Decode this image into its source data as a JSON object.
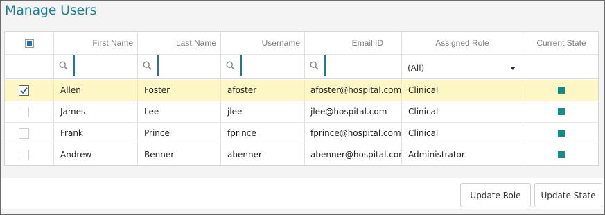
{
  "page": {
    "title": "Manage Users"
  },
  "grid": {
    "columns": [
      "First Name",
      "Last Name",
      "Username",
      "Email ID",
      "Assigned Role",
      "Current State"
    ],
    "role_filter": {
      "selected": "(All)"
    },
    "rows": [
      {
        "first": "Allen",
        "last": "Foster",
        "username": "afoster",
        "email": "afoster@hospital.com",
        "role": "Clinical",
        "checked": true
      },
      {
        "first": "James",
        "last": "Lee",
        "username": "jlee",
        "email": "jlee@hospital.com",
        "role": "Clinical",
        "checked": false
      },
      {
        "first": "Frank",
        "last": "Prince",
        "username": "fprince",
        "email": "fprince@hospital.com",
        "role": "Clinical",
        "checked": false
      },
      {
        "first": "Andrew",
        "last": "Benner",
        "username": "abenner",
        "email": "abenner@hospital.com",
        "role": "Administrator",
        "checked": false
      }
    ],
    "state_color": "#138e86",
    "accent": "#1f7f92",
    "selected_row_color": "#fdf6c5"
  },
  "actions": {
    "update_role": "Update Role",
    "update_state": "Update State"
  },
  "icons": {
    "filter": "search-icon",
    "state": "status-square",
    "dropdown": "chevron-down-icon"
  }
}
